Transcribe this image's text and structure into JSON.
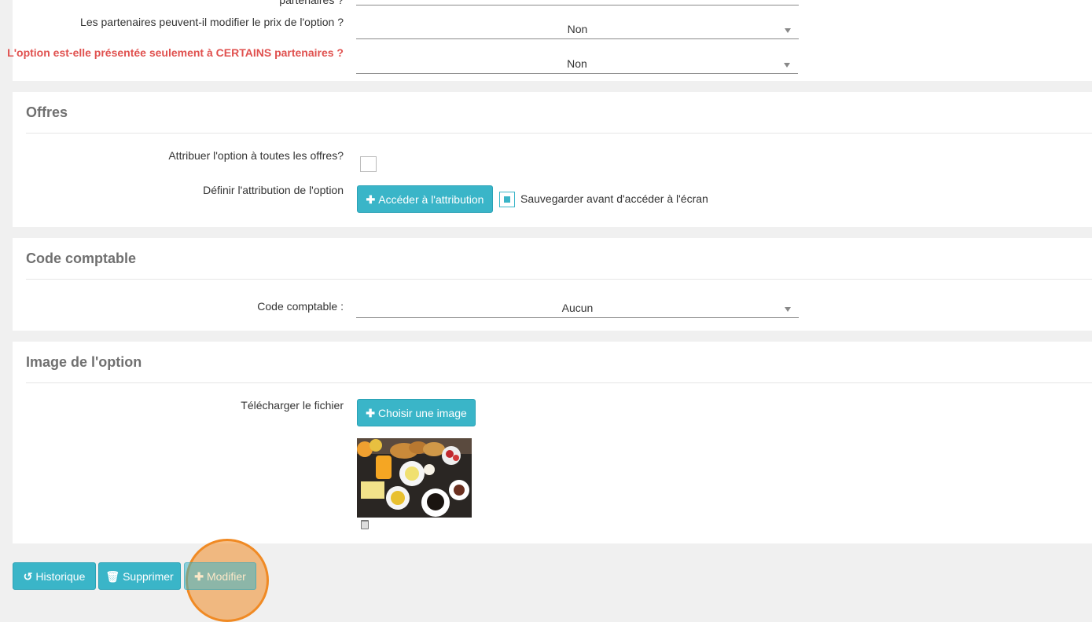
{
  "partners": {
    "cut_label": "partenaires ?",
    "modify_price_label": "Les partenaires peuvent-il modifier le prix de l'option ?",
    "modify_price_value": "Non",
    "certain_partners_label": "L'option est-elle présentée seulement à CERTAINS partenaires ?",
    "certain_partners_value": "Non"
  },
  "offres": {
    "title": "Offres",
    "assign_all_label": "Attribuer l'option à toutes les offres?",
    "assign_all_checked": false,
    "define_label": "Définir l'attribution de l'option",
    "access_button": "Accéder à l'attribution",
    "save_before_label": "Sauvegarder avant d'accéder à l'écran",
    "save_before_checked": true
  },
  "code": {
    "title": "Code comptable",
    "label": "Code comptable :",
    "value": "Aucun"
  },
  "image": {
    "title": "Image de l'option",
    "upload_label": "Télécharger le fichier",
    "choose_button": "Choisir une image"
  },
  "footer": {
    "history_button": "Historique",
    "delete_button": "Supprimer",
    "modify_button": "Modifier"
  },
  "colors": {
    "accent": "#3ab5c8",
    "alert": "#e0514f",
    "highlight": "#f08a24"
  }
}
